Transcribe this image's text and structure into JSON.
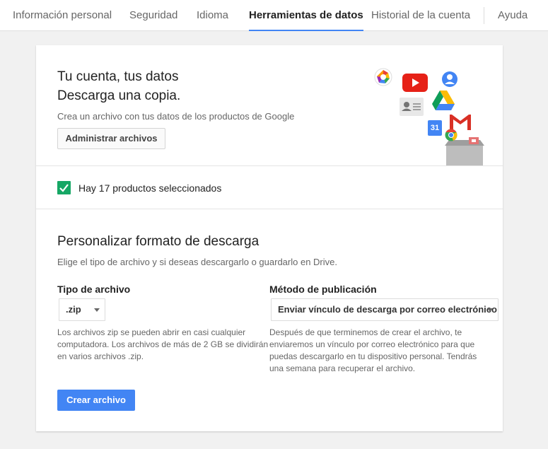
{
  "nav": {
    "tabs": [
      {
        "label": "Información personal"
      },
      {
        "label": "Seguridad"
      },
      {
        "label": "Idioma"
      },
      {
        "label": "Herramientas de datos"
      },
      {
        "label": "Historial de la cuenta"
      },
      {
        "label": "Ayuda"
      }
    ],
    "active_tab": "Herramientas de datos"
  },
  "download": {
    "title_line1": "Tu cuenta, tus datos",
    "title_line2": "Descarga una copia.",
    "subtitle": "Crea un archivo con tus datos de los productos de Google",
    "manage_button": "Administrar archivos",
    "product_icons": [
      "picasa-icon",
      "youtube-icon",
      "profile-icon",
      "contacts-icon",
      "drive-icon",
      "calendar-icon",
      "gmail-icon",
      "chrome-icon",
      "box-icon"
    ],
    "calendar_day": "31"
  },
  "selection": {
    "checked": true,
    "label": "Hay 17 productos seleccionados"
  },
  "format": {
    "title": "Personalizar formato de descarga",
    "description": "Elige el tipo de archivo y si deseas descargarlo o guardarlo en Drive.",
    "file_type": {
      "label": "Tipo de archivo",
      "selected": ".zip",
      "help_lines": [
        "Los archivos zip se pueden abrir en casi cualquier",
        "computadora. Los archivos de más de 2 GB se dividirán",
        "en varios archivos .zip."
      ]
    },
    "delivery": {
      "label": "Método de publicación",
      "selected": "Enviar vínculo de descarga por correo electrónico",
      "help_lines": [
        "Después de que terminemos de crear el archivo, te",
        "enviaremos un vínculo por correo electrónico para que",
        "puedas descargarlo en tu dispositivo personal. Tendrás",
        "una semana para recuperar el archivo."
      ]
    },
    "create_button": "Crear archivo"
  },
  "colors": {
    "accent_blue": "#4285f4",
    "check_green": "#16a765",
    "page_bg": "#f1f1f1"
  }
}
